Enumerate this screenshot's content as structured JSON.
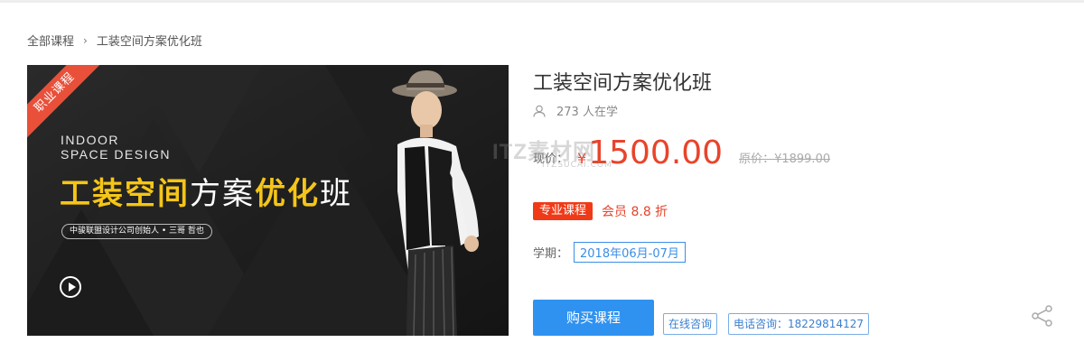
{
  "breadcrumb": {
    "root": "全部课程",
    "separator": "›",
    "current": "工装空间方案优化班"
  },
  "banner": {
    "ribbon": "职业课程",
    "en_line1": "INDOOR",
    "en_line2": "SPACE DESIGN",
    "title_part1": "工装空间",
    "title_part2": "方案",
    "title_part3": "优化",
    "title_part4": "班",
    "subtitle": "中骏联盟设计公司创始人 • 三哥   哲也",
    "play_icon": "play-circle-icon"
  },
  "course": {
    "title": "工装空间方案优化班",
    "learners": "273 人在学",
    "price_label": "现价：",
    "currency": "¥",
    "price": "1500.00",
    "original_price": "原价：¥1899.00",
    "pro_tag": "专业课程",
    "member_discount": "会员  8.8  折",
    "term_label": "学期：",
    "term_value": "2018年06月-07月"
  },
  "actions": {
    "buy": "购买课程",
    "online_consult": "在线咨询",
    "phone_consult": "电话咨询：18229814127",
    "share_icon": "share-icon"
  },
  "watermark": {
    "main": "ITZ素材网",
    "sub": "ITZSUCAI.COM"
  },
  "colors": {
    "price_red": "#e8442b",
    "primary_blue": "#2f92f0",
    "accent_yellow": "#f5c518",
    "ribbon_red": "#e8503a"
  }
}
